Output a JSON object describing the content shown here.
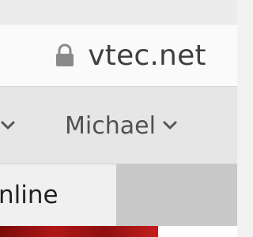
{
  "address_bar": {
    "url_text": "vtec.net",
    "secure_icon": "lock-icon"
  },
  "toolbar": {
    "partial_item_icon": "chevron-down-icon",
    "user_menu_label": "Michael",
    "user_menu_icon": "chevron-down-icon"
  },
  "tabs": {
    "active_tab_label_partial": "nline"
  },
  "colors": {
    "content_accent": "#b01717"
  }
}
